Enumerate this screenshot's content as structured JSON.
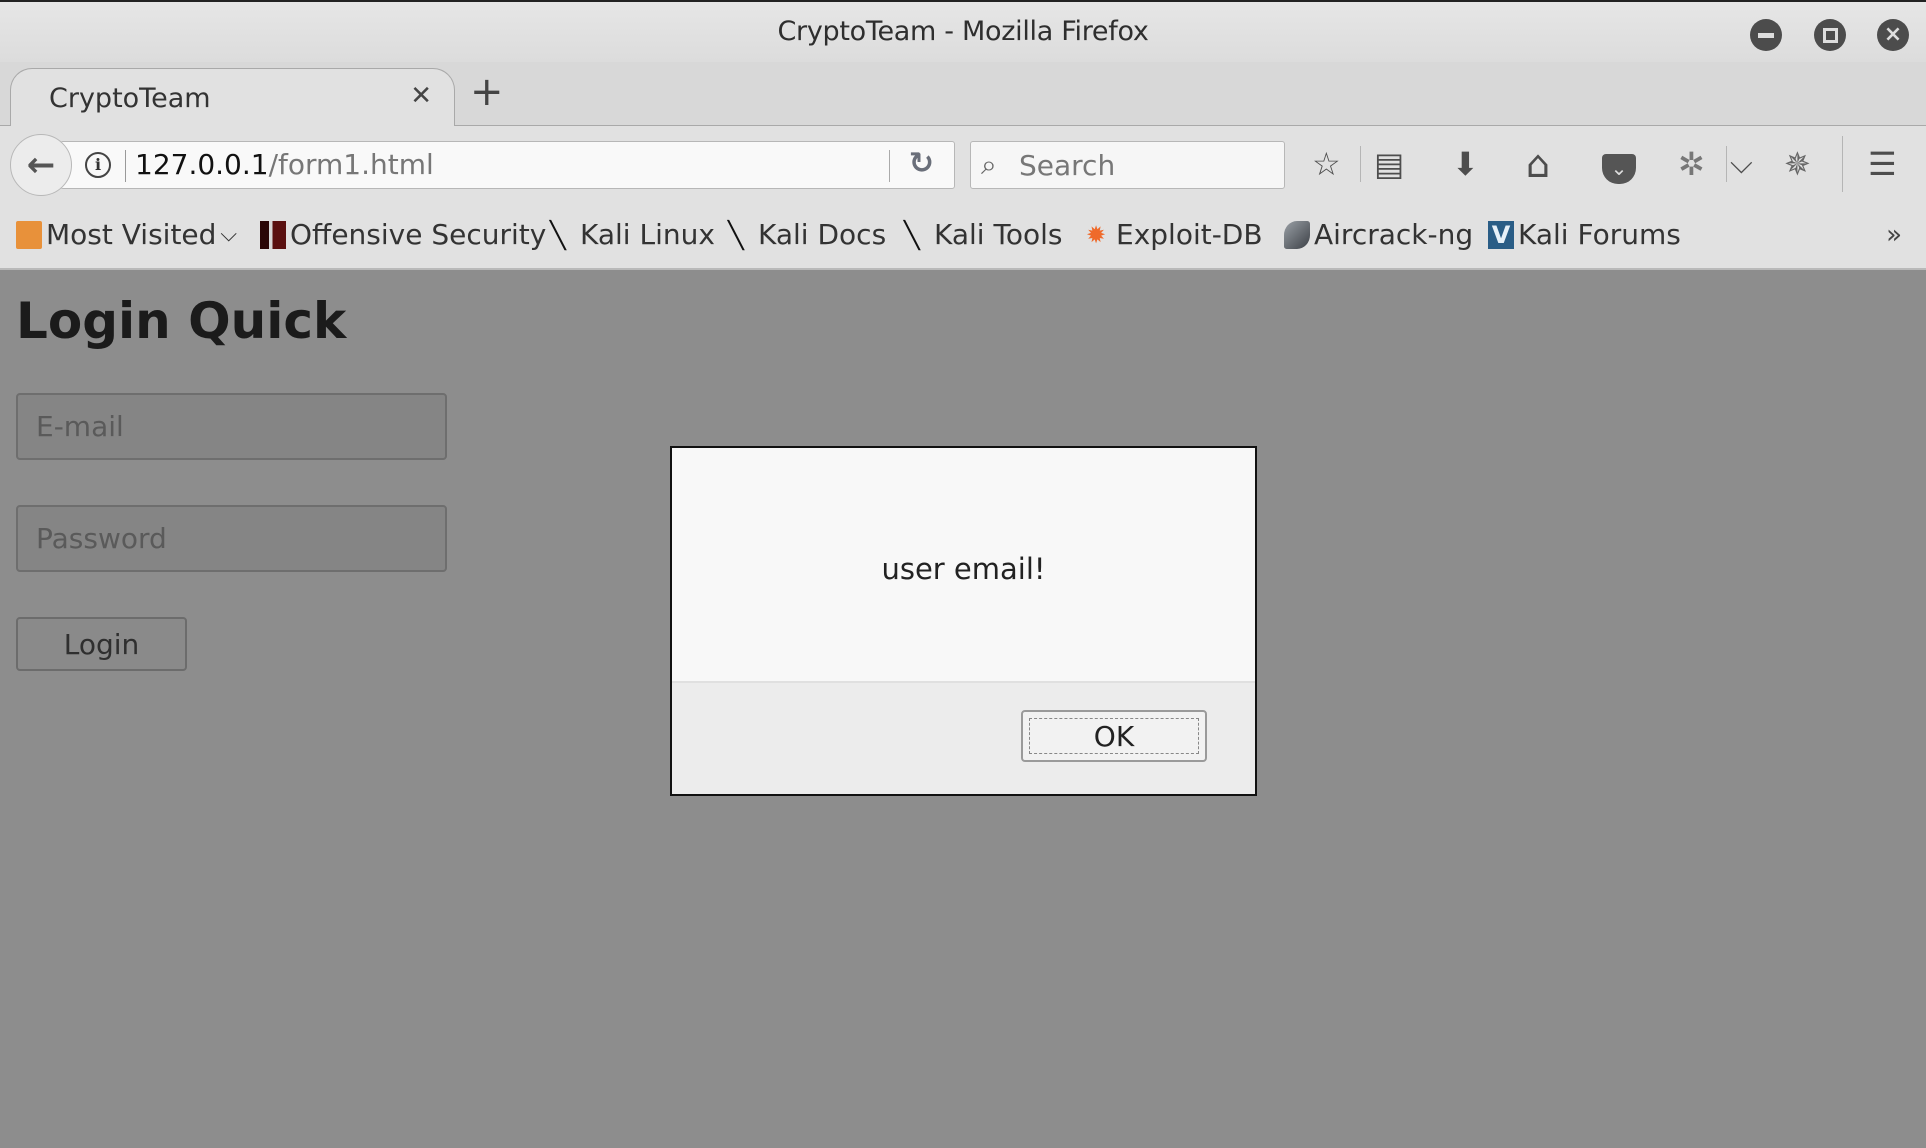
{
  "window": {
    "title": "CryptoTeam - Mozilla Firefox",
    "controls": {
      "minimize": "−",
      "maximize": "□",
      "close": "✕"
    }
  },
  "tabs": [
    {
      "label": "CryptoTeam",
      "close": "✕",
      "active": true
    }
  ],
  "new_tab_label": "+",
  "navbar": {
    "back": "🡐",
    "info": "i",
    "url_host": "127.0.0.1",
    "url_path": "/form1.html",
    "reload": "↻",
    "search_placeholder": "Search",
    "search_icon": "🔍",
    "toolbar_icons": {
      "bookmark_star": "☆",
      "reading_list": "▤",
      "downloads": "🡓",
      "home": "⌂",
      "pocket": "◙",
      "extension_bug": "✲",
      "extension_dropdown": "⌄",
      "extension_spider": "✵",
      "menu": "☰"
    }
  },
  "bookmarks": {
    "items": [
      {
        "label": "Most Visited",
        "icon": "folder-icon",
        "dropdown": "⌄",
        "color": "#e8913a"
      },
      {
        "label": "Offensive Security",
        "icon": "offsec-icon",
        "color": "#5a1010"
      },
      {
        "label": "Kali Linux",
        "icon": "kali-dragon-icon",
        "color": "#111111"
      },
      {
        "label": "Kali Docs",
        "icon": "kali-dragon-icon",
        "color": "#111111"
      },
      {
        "label": "Kali Tools",
        "icon": "kali-dragon-icon",
        "color": "#111111"
      },
      {
        "label": "Exploit-DB",
        "icon": "exploitdb-icon",
        "color": "#ef6a2b"
      },
      {
        "label": "Aircrack-ng",
        "icon": "aircrack-icon",
        "color": "#555a60"
      },
      {
        "label": "Kali Forums",
        "icon": "kali-forums-icon",
        "color": "#2a5d86"
      }
    ],
    "overflow": "»"
  },
  "page": {
    "title": "Login Quick",
    "email_placeholder": "E-mail",
    "password_placeholder": "Password",
    "login_label": "Login"
  },
  "dialog": {
    "message": "user email!",
    "ok_label": "OK"
  }
}
